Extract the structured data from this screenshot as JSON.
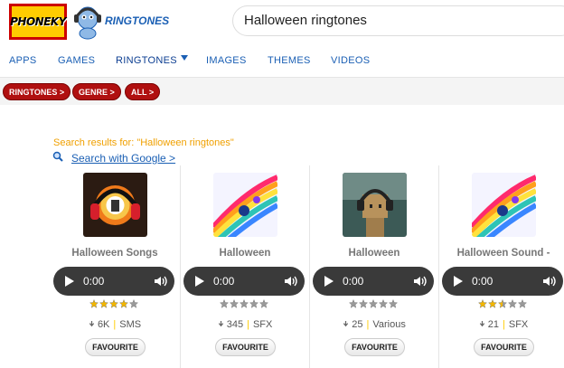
{
  "header": {
    "logo_text": "PHONEKY",
    "brand_sub": "RINGTONES",
    "search_value": "Halloween ringtones"
  },
  "nav": {
    "items": [
      "APPS",
      "GAMES",
      "RINGTONES",
      "IMAGES",
      "THEMES",
      "VIDEOS"
    ]
  },
  "breadcrumbs": [
    "RINGTONES >",
    "GENRE >",
    "ALL >"
  ],
  "results": {
    "label": "Search results for: \"Halloween ringtones\"",
    "google_link": "Search with Google >"
  },
  "cards": [
    {
      "title": "Halloween Songs",
      "time": "0:00",
      "rating": 4,
      "downloads": "6K",
      "category": "SMS",
      "favourite": "FAVOURITE",
      "thumb_icon": "headphones-face-icon"
    },
    {
      "title": "Halloween",
      "time": "0:00",
      "rating": 0,
      "downloads": "345",
      "category": "SFX",
      "favourite": "FAVOURITE",
      "thumb_icon": "rainbow-music-icon"
    },
    {
      "title": "Halloween",
      "time": "0:00",
      "rating": 0,
      "downloads": "25",
      "category": "Various",
      "favourite": "FAVOURITE",
      "thumb_icon": "boxman-headphones-icon"
    },
    {
      "title": "Halloween Sound -",
      "time": "0:00",
      "rating": 2.5,
      "downloads": "21",
      "category": "SFX",
      "favourite": "FAVOURITE",
      "thumb_icon": "rainbow-music-icon"
    }
  ],
  "colors": {
    "accent_blue": "#1a5fb4",
    "pill_red": "#b01010",
    "results_orange": "#f0a000",
    "star_gold": "#f2b600"
  }
}
